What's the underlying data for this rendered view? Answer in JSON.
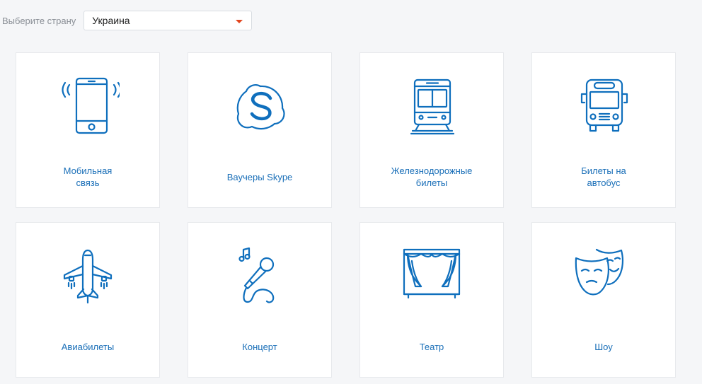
{
  "country": {
    "label": "Выберите страну",
    "selected": "Украина"
  },
  "colors": {
    "accent": "#1a6fb8",
    "icon": "#0f6fbd",
    "caret": "#e2451e"
  },
  "cards": [
    {
      "icon": "mobile-phone-icon",
      "label_lines": [
        "Мобильная",
        "связь"
      ]
    },
    {
      "icon": "skype-icon",
      "label_lines": [
        "Ваучеры Skype"
      ]
    },
    {
      "icon": "train-icon",
      "label_lines": [
        "Железнодорожные",
        "билеты"
      ]
    },
    {
      "icon": "bus-icon",
      "label_lines": [
        "Билеты на",
        "автобус"
      ]
    },
    {
      "icon": "airplane-icon",
      "label_lines": [
        "Авиабилеты"
      ]
    },
    {
      "icon": "microphone-icon",
      "label_lines": [
        "Концерт"
      ]
    },
    {
      "icon": "theater-curtain-icon",
      "label_lines": [
        "Театр"
      ]
    },
    {
      "icon": "theater-masks-icon",
      "label_lines": [
        "Шоу"
      ]
    }
  ]
}
